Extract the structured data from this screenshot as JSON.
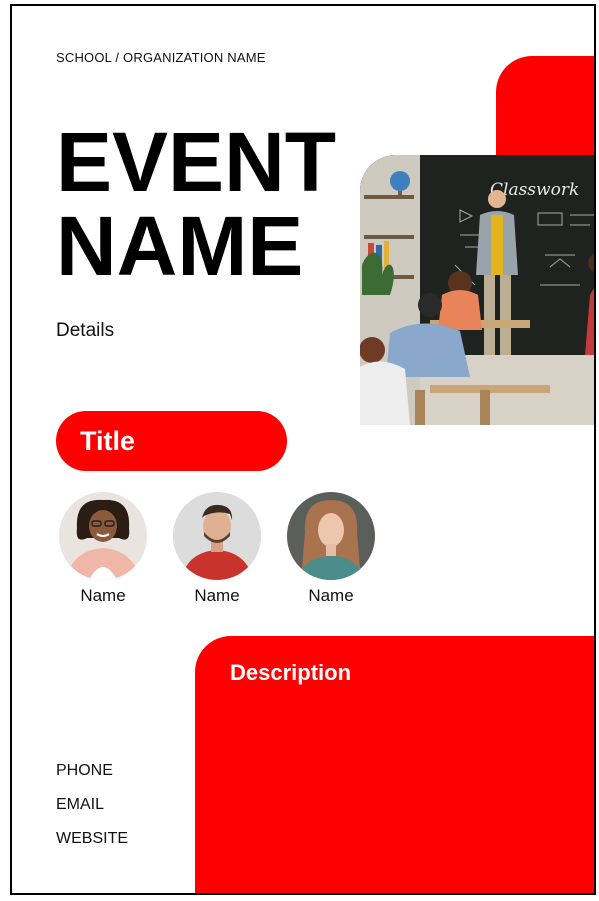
{
  "organization": "SCHOOL / ORGANIZATION NAME",
  "event": {
    "line1": "EVENT",
    "line2": "NAME"
  },
  "details": "Details",
  "title_pill": "Title",
  "people": [
    {
      "name": "Name"
    },
    {
      "name": "Name"
    },
    {
      "name": "Name"
    }
  ],
  "description_heading": "Description",
  "contact": {
    "phone": "PHONE",
    "email": "EMAIL",
    "website": "WEBSITE"
  },
  "photo_chalkboard_text": "Classwork",
  "colors": {
    "accent": "#ff0000",
    "text": "#000000",
    "background": "#ffffff"
  }
}
